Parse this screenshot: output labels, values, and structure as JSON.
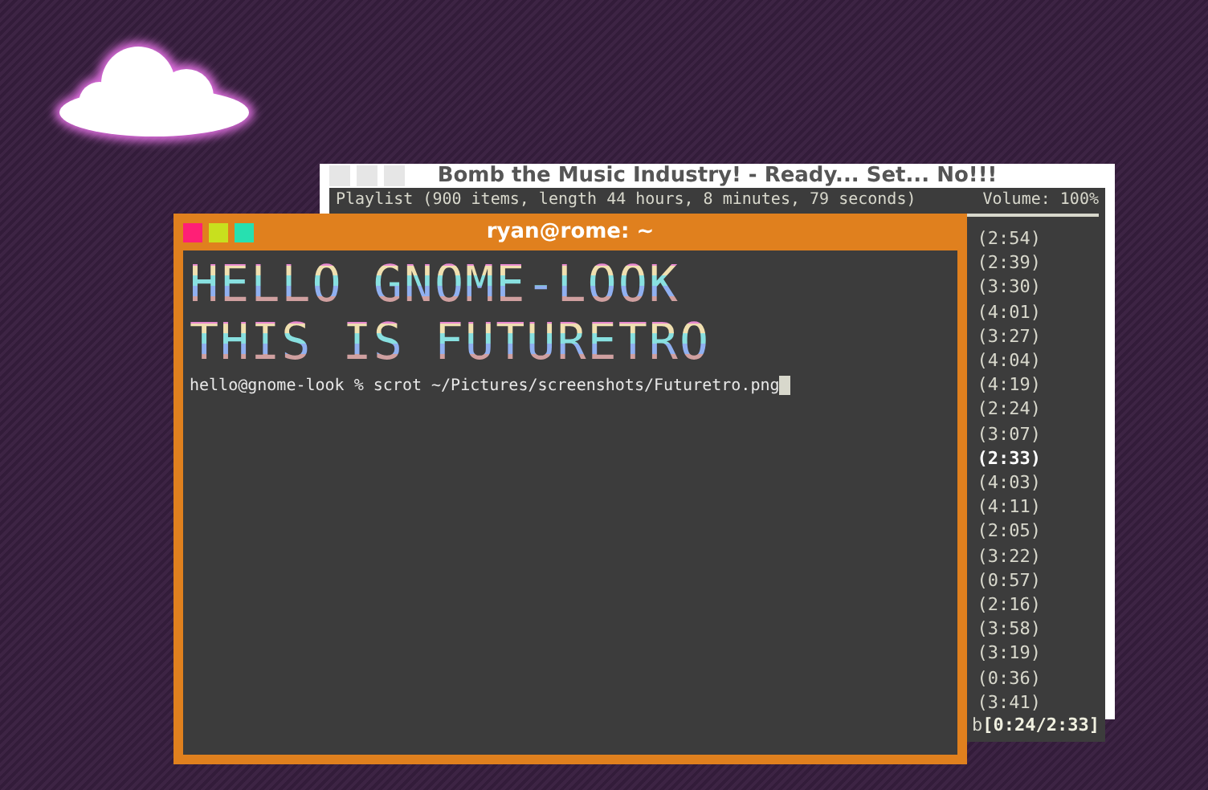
{
  "music_window": {
    "title": "Bomb the Music Industry! - Ready... Set... No!!!",
    "header": "Playlist (900 items, length 44 hours, 8 minutes, 79 seconds)",
    "volume": "Volume: 100%",
    "tracks": [
      {
        "duration": "(2:54)",
        "selected": false
      },
      {
        "duration": "(2:39)",
        "selected": false
      },
      {
        "duration": "(3:30)",
        "selected": false
      },
      {
        "duration": "(4:01)",
        "selected": false
      },
      {
        "duration": "(3:27)",
        "selected": false
      },
      {
        "duration": "(4:04)",
        "selected": false
      },
      {
        "duration": "(4:19)",
        "selected": false
      },
      {
        "duration": "(2:24)",
        "selected": false
      },
      {
        "duration": "(3:07)",
        "selected": false
      },
      {
        "duration": "(2:33)",
        "selected": true
      },
      {
        "duration": "(4:03)",
        "selected": false
      },
      {
        "duration": "(4:11)",
        "selected": false
      },
      {
        "duration": "(2:05)",
        "selected": false
      },
      {
        "duration": "(3:22)",
        "selected": false
      },
      {
        "duration": "(0:57)",
        "selected": false
      },
      {
        "duration": "(2:16)",
        "selected": false
      },
      {
        "duration": "(3:58)",
        "selected": false
      },
      {
        "duration": "(3:19)",
        "selected": false
      },
      {
        "duration": "(0:36)",
        "selected": false
      },
      {
        "duration": "(3:41)",
        "selected": false
      }
    ],
    "status_left": "b",
    "progress": "[0:24/2:33]"
  },
  "terminal": {
    "title": "ryan@rome: ~",
    "banner": [
      "HELLO GNOME-LOOK",
      "THIS IS FUTURETRO"
    ],
    "prompt": "hello@gnome-look % scrot ~/Pictures/screenshots/Futuretro.png"
  }
}
